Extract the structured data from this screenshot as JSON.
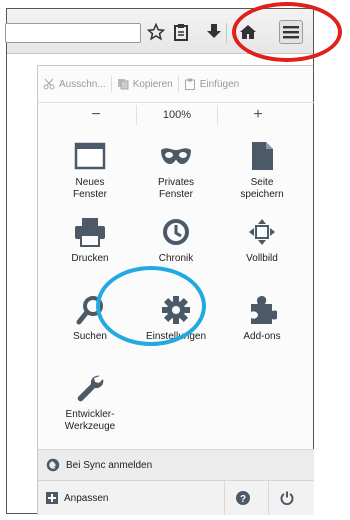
{
  "edit": {
    "cut": "Ausschn...",
    "copy": "Kopieren",
    "paste": "Einfügen"
  },
  "zoom": {
    "minus": "−",
    "value": "100%",
    "plus": "+"
  },
  "grid": [
    {
      "label": "Neues\nFenster",
      "icon": "new-window-icon"
    },
    {
      "label": "Privates\nFenster",
      "icon": "private-window-icon"
    },
    {
      "label": "Seite\nspeichern",
      "icon": "save-page-icon"
    },
    {
      "label": "Drucken",
      "icon": "print-icon"
    },
    {
      "label": "Chronik",
      "icon": "history-icon"
    },
    {
      "label": "Vollbild",
      "icon": "fullscreen-icon"
    },
    {
      "label": "Suchen",
      "icon": "search-icon"
    },
    {
      "label": "Einstellungen",
      "icon": "settings-gear-icon"
    },
    {
      "label": "Add-ons",
      "icon": "addons-icon"
    },
    {
      "label": "Entwickler-\nWerkzeuge",
      "icon": "developer-tools-icon"
    }
  ],
  "sync": {
    "label": "Bei Sync anmelden"
  },
  "footer": {
    "customize": "Anpassen"
  },
  "colors": {
    "highlight_red": "#e0201d",
    "highlight_blue": "#22a9e2"
  }
}
